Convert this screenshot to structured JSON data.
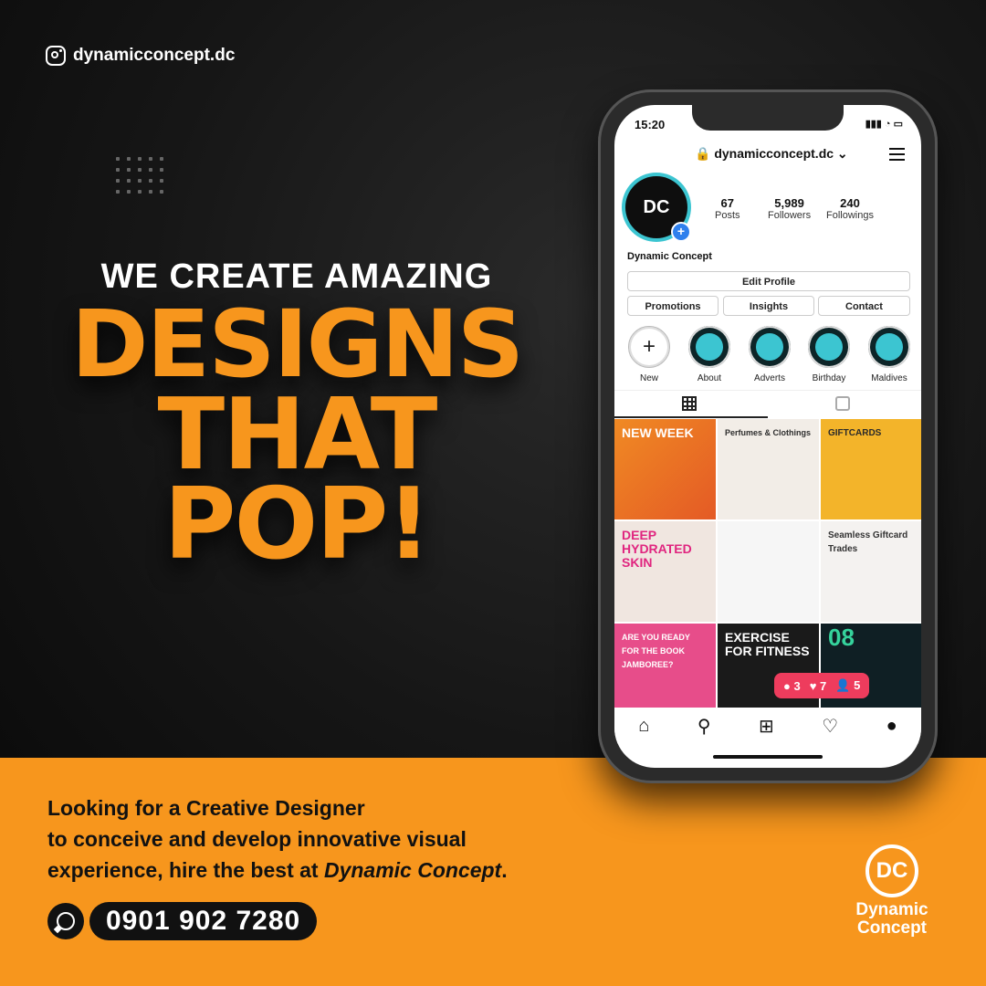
{
  "header": {
    "instagram_handle": "dynamicconcept.dc",
    "icon": "instagram-icon"
  },
  "headline": {
    "line1": "WE CREATE AMAZING",
    "line2": "DESIGNS",
    "line3": "THAT",
    "line4": "POP!"
  },
  "blurb": {
    "line1": "Looking for a Creative Designer",
    "line2": "to conceive and develop innovative visual",
    "line3_prefix": "experience, hire the best at ",
    "line3_italic": "Dynamic Concept",
    "line3_suffix": "."
  },
  "contact": {
    "phone": "0901 902 7280",
    "icon": "whatsapp-icon"
  },
  "brand": {
    "logo_text": "DC",
    "name_line1": "Dynamic",
    "name_line2": "Concept"
  },
  "phone_ui": {
    "time": "15:20",
    "username": "dynamicconcept.dc",
    "avatar_text": "DC",
    "stats": [
      {
        "value": "67",
        "label": "Posts"
      },
      {
        "value": "5,989",
        "label": "Followers"
      },
      {
        "value": "240",
        "label": "Followings"
      }
    ],
    "profile_name": "Dynamic Concept",
    "edit_profile": "Edit Profile",
    "buttons": [
      "Promotions",
      "Insights",
      "Contact"
    ],
    "highlights": [
      "New",
      "About",
      "Adverts",
      "Birthday",
      "Maldives"
    ],
    "posts": [
      "NEW WEEK",
      "Perfumes & Clothings",
      "GIFTCARDS",
      "DEEP HYDRATED SKIN",
      "",
      "Seamless Giftcard Trades",
      "ARE YOU READY FOR THE BOOK JAMBOREE?",
      "EXERCISE FOR FITNESS",
      "08"
    ],
    "notification": {
      "comments": "3",
      "likes": "7",
      "follows": "5"
    }
  },
  "colors": {
    "accent": "#f7961d",
    "dark": "#141414",
    "teal": "#3cc5d1"
  }
}
